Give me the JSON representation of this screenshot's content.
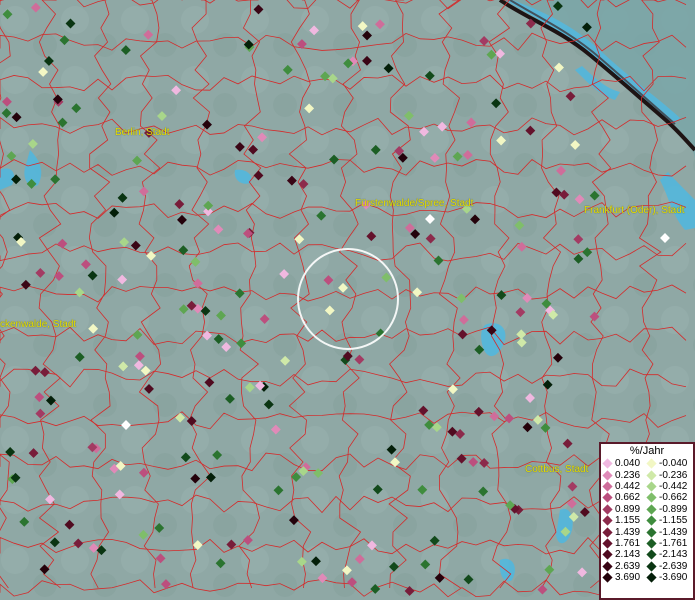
{
  "cities": [
    {
      "id": "berlin",
      "name": "Berlin, Stadt"
    },
    {
      "id": "fuerstenwalde",
      "name": "Fürstenwalde/Spree, Stadt"
    },
    {
      "id": "frankfurt",
      "name": "Frankfurt (Oder), Stadt"
    },
    {
      "id": "luckenwalde",
      "name": "ckenwalde, Stadt"
    },
    {
      "id": "cottbus",
      "name": "Cottbus, Stadt"
    }
  ],
  "legend": {
    "title": "%/Jahr",
    "positive": [
      {
        "value": "0.040",
        "color": "#f0b8e0"
      },
      {
        "value": "0.236",
        "color": "#e08ab8"
      },
      {
        "value": "0.442",
        "color": "#cf6d9a"
      },
      {
        "value": "0.662",
        "color": "#bc4f7e"
      },
      {
        "value": "0.899",
        "color": "#a33b63"
      },
      {
        "value": "1.155",
        "color": "#8c2a4b"
      },
      {
        "value": "1.439",
        "color": "#781d3a"
      },
      {
        "value": "1.761",
        "color": "#64122c"
      },
      {
        "value": "2.143",
        "color": "#500b20"
      },
      {
        "value": "2.639",
        "color": "#3a0515"
      },
      {
        "value": "3.690",
        "color": "#24020b"
      }
    ],
    "negative": [
      {
        "value": "-0.040",
        "color": "#f2f7c4"
      },
      {
        "value": "-0.236",
        "color": "#cfe9a8"
      },
      {
        "value": "-0.442",
        "color": "#a8d68a"
      },
      {
        "value": "-0.662",
        "color": "#7fbe6a"
      },
      {
        "value": "-0.899",
        "color": "#5ea652"
      },
      {
        "value": "-1.155",
        "color": "#3f8d3e"
      },
      {
        "value": "-1.439",
        "color": "#2b7430"
      },
      {
        "value": "-1.761",
        "color": "#1c5e24"
      },
      {
        "value": "-2.143",
        "color": "#124a1b"
      },
      {
        "value": "-2.639",
        "color": "#0a3512"
      },
      {
        "value": "-3.690",
        "color": "#041f09"
      }
    ]
  },
  "colors": {
    "background": "#8fa8a5",
    "boundary": "#d42a2a",
    "water": "#4fb8e0",
    "label": "#e8e000",
    "focus_ring": "#ffffff",
    "white_point": "#ffffff"
  }
}
